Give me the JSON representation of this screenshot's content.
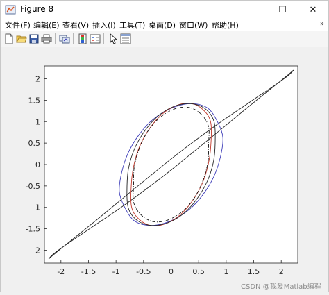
{
  "window": {
    "title": "Figure 8",
    "minimize_symbol": "—",
    "maximize_symbol": "☐",
    "close_symbol": "✕"
  },
  "menu": {
    "items": [
      "文件(F)",
      "编辑(E)",
      "查看(V)",
      "插入(I)",
      "工具(T)",
      "桌面(D)",
      "窗口(W)",
      "帮助(H)"
    ],
    "overflow_symbol": "»"
  },
  "toolbar": {
    "buttons": [
      "new-figure-icon",
      "open-file-icon",
      "save-icon",
      "print-icon",
      "link-plot-icon",
      "insert-colorbar-icon",
      "insert-legend-icon",
      "pointer-icon",
      "property-inspector-icon"
    ]
  },
  "watermark": "CSDN @我爱Matlab编程",
  "colors": {
    "black_curve": "#222222",
    "blue_curve": "#3b3bb8",
    "red_curve": "#c0392b",
    "dashdot_curve": "#111111"
  },
  "chart_data": {
    "type": "line",
    "title": "",
    "xlabel": "",
    "ylabel": "",
    "xlim": [
      -2.3,
      2.3
    ],
    "ylim": [
      -2.3,
      2.3
    ],
    "xticks": [
      -2,
      -1.5,
      -1,
      -0.5,
      0,
      0.5,
      1,
      1.5,
      2
    ],
    "yticks": [
      -2,
      -1.5,
      -1,
      -0.5,
      0,
      0.5,
      1,
      1.5,
      2
    ],
    "xtick_labels": [
      "-2",
      "-1.5",
      "-1",
      "-0.5",
      "0",
      "0.5",
      "1",
      "1.5",
      "2"
    ],
    "ytick_labels": [
      "-2",
      "-1.5",
      "-1",
      "-0.5",
      "0",
      "0.5",
      "1",
      "1.5",
      "2"
    ],
    "grid": false,
    "series": [
      {
        "style": "solid",
        "color": "#222222",
        "x": [
          2.13,
          1.88,
          1.34,
          0.64,
          -0.11,
          -0.81,
          -1.4,
          -1.85,
          -2.13,
          -2.22,
          -2.13,
          -1.88,
          -1.34,
          -0.64,
          0.11,
          0.81,
          1.4,
          1.85,
          2.13,
          2.22,
          2.13
        ],
        "y": [
          2.1,
          1.84,
          1.28,
          0.54,
          -0.24,
          -0.91,
          -1.43,
          -1.82,
          -2.08,
          -2.2,
          -2.1,
          -1.84,
          -1.28,
          -0.54,
          0.24,
          0.91,
          1.43,
          1.82,
          2.08,
          2.2,
          2.1
        ]
      },
      {
        "style": "solid",
        "color": "#3b3bb8",
        "x": [
          0.85,
          0.66,
          0.35,
          0.0,
          -0.33,
          -0.58,
          -0.78,
          -0.9,
          -0.94,
          -0.85,
          -0.66,
          -0.35,
          0.0,
          0.33,
          0.58,
          0.78,
          0.9,
          0.94,
          0.85
        ],
        "y": [
          0.98,
          1.32,
          1.42,
          1.31,
          1.05,
          0.7,
          0.27,
          -0.2,
          -0.63,
          -0.98,
          -1.32,
          -1.42,
          -1.31,
          -1.05,
          -0.7,
          -0.27,
          0.2,
          0.63,
          0.98
        ]
      },
      {
        "style": "solid",
        "color": "#c0392b",
        "x": [
          0.72,
          0.58,
          0.35,
          0.1,
          -0.16,
          -0.38,
          -0.56,
          -0.67,
          -0.72,
          -0.72,
          -0.58,
          -0.35,
          -0.1,
          0.16,
          0.38,
          0.56,
          0.67,
          0.72,
          0.72
        ],
        "y": [
          0.98,
          1.28,
          1.43,
          1.38,
          1.18,
          0.86,
          0.46,
          0.02,
          -0.42,
          -0.98,
          -1.28,
          -1.43,
          -1.38,
          -1.18,
          -0.86,
          -0.46,
          -0.02,
          0.42,
          0.98
        ]
      },
      {
        "style": "solid",
        "color": "#222222",
        "x": [
          0.78,
          0.62,
          0.36,
          0.06,
          -0.23,
          -0.47,
          -0.66,
          -0.77,
          -0.8,
          -0.78,
          -0.62,
          -0.36,
          -0.06,
          0.23,
          0.47,
          0.66,
          0.77,
          0.8,
          0.78
        ],
        "y": [
          1.0,
          1.3,
          1.42,
          1.36,
          1.14,
          0.8,
          0.38,
          -0.07,
          -0.5,
          -1.0,
          -1.3,
          -1.42,
          -1.36,
          -1.14,
          -0.8,
          -0.38,
          0.07,
          0.5,
          1.0
        ]
      },
      {
        "style": "dashdot",
        "color": "#111111",
        "x": [
          0.68,
          0.55,
          0.33,
          0.07,
          -0.2,
          -0.42,
          -0.58,
          -0.67,
          -0.68,
          -0.68,
          -0.55,
          -0.33,
          -0.07,
          0.2,
          0.42,
          0.58,
          0.67,
          0.68,
          0.68
        ],
        "y": [
          0.88,
          1.17,
          1.33,
          1.3,
          1.1,
          0.78,
          0.37,
          -0.07,
          -0.48,
          -0.88,
          -1.17,
          -1.33,
          -1.3,
          -1.1,
          -0.78,
          -0.37,
          0.07,
          0.48,
          0.88
        ]
      }
    ]
  }
}
